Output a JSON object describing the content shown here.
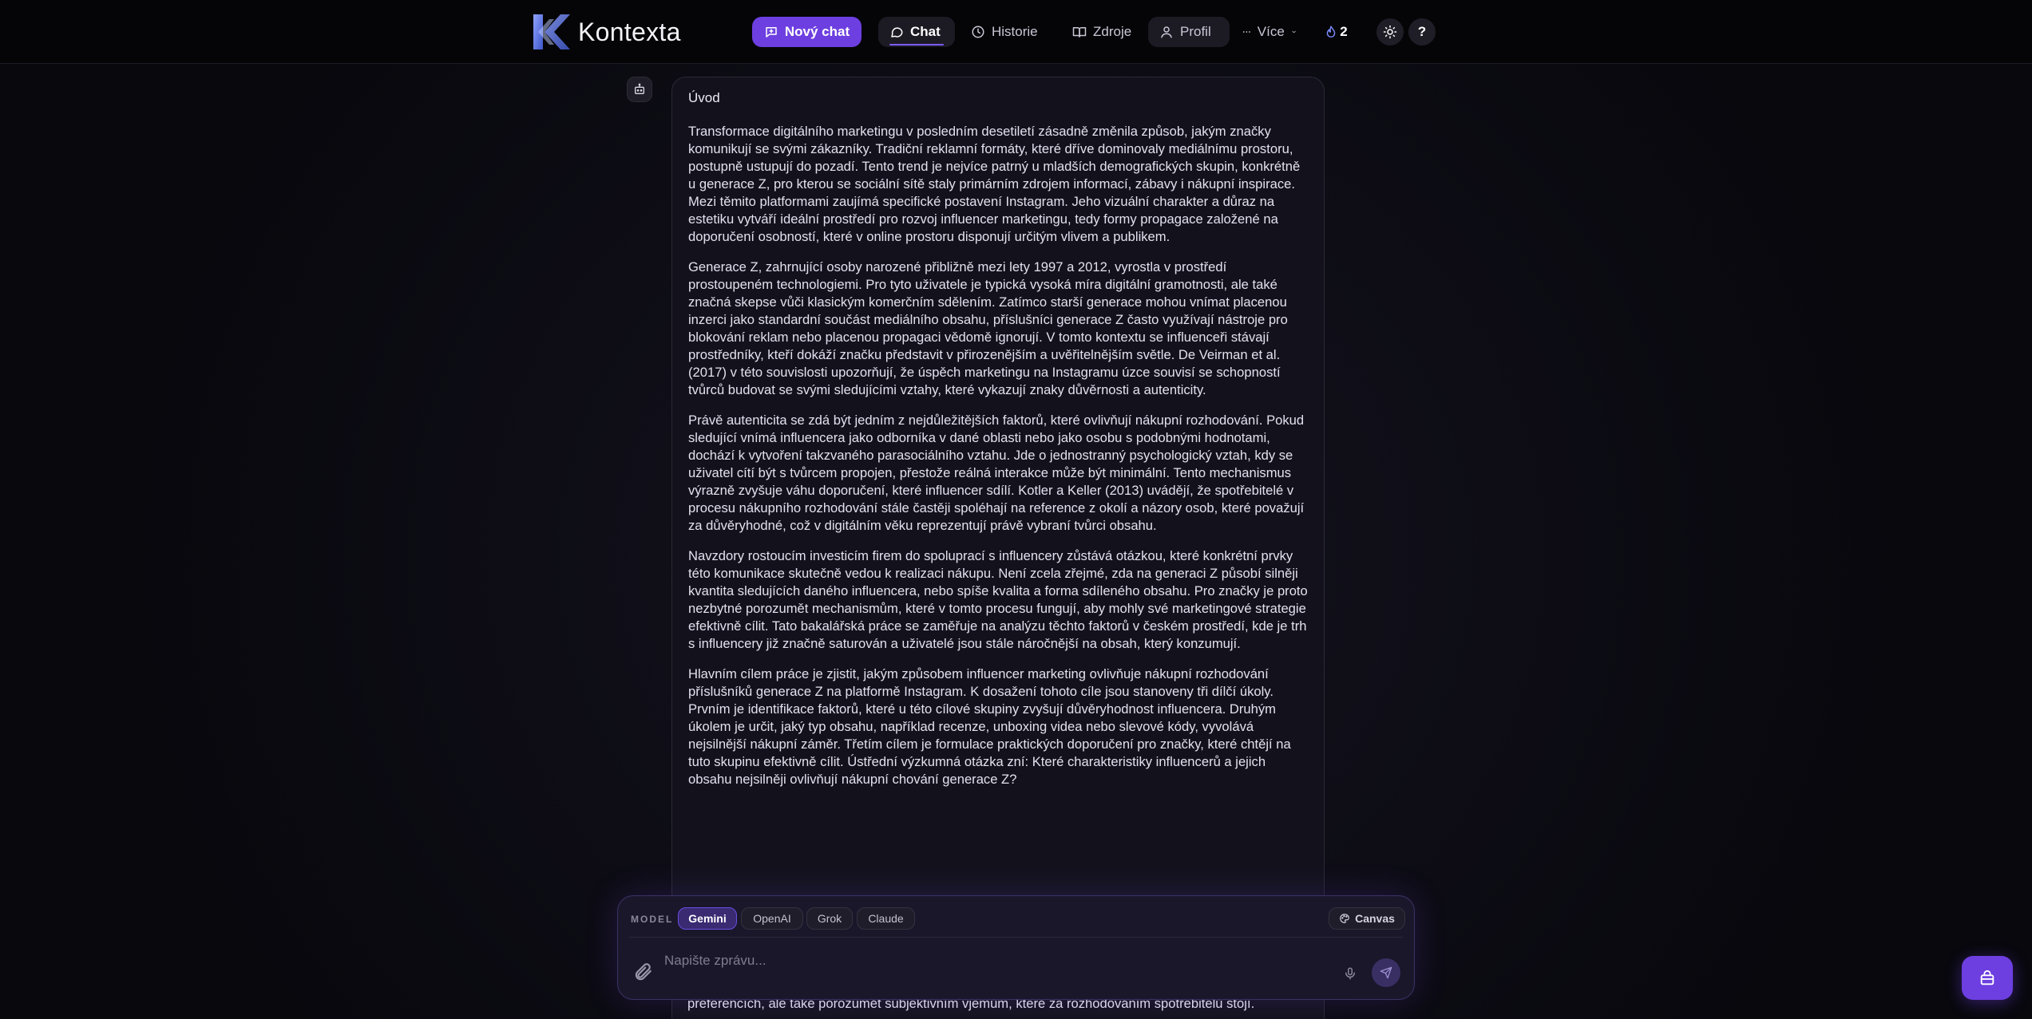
{
  "header": {
    "app_name": "Kontexta",
    "new_chat_label": "Nový chat",
    "nav": {
      "chat": "Chat",
      "history": "Historie",
      "sources": "Zdroje",
      "profile": "Profil",
      "more": "Více"
    },
    "count_badge": "2",
    "help_label": "?"
  },
  "message": {
    "heading": "Úvod",
    "paragraphs": [
      "Transformace digitálního marketingu v posledním desetiletí zásadně změnila způsob, jakým značky komunikují se svými zákazníky. Tradiční reklamní formáty, které dříve dominovaly mediálnímu prostoru, postupně ustupují do pozadí. Tento trend je nejvíce patrný u mladších demografických skupin, konkrétně u generace Z, pro kterou se sociální sítě staly primárním zdrojem informací, zábavy i nákupní inspirace. Mezi těmito platformami zaujímá specifické postavení Instagram. Jeho vizuální charakter a důraz na estetiku vytváří ideální prostředí pro rozvoj influencer marketingu, tedy formy propagace založené na doporučení osobností, které v online prostoru disponují určitým vlivem a publikem.",
      "Generace Z, zahrnující osoby narozené přibližně mezi lety 1997 a 2012, vyrostla v prostředí prostoupeném technologiemi. Pro tyto uživatele je typická vysoká míra digitální gramotnosti, ale také značná skepse vůči klasickým komerčním sdělením. Zatímco starší generace mohou vnímat placenou inzerci jako standardní součást mediálního obsahu, příslušníci generace Z často využívají nástroje pro blokování reklam nebo placenou propagaci vědomě ignorují. V tomto kontextu se influenceři stávají prostředníky, kteří dokáží značku představit v přirozenějším a uvěřitelnějším světle. De Veirman et al. (2017) v této souvislosti upozorňují, že úspěch marketingu na Instagramu úzce souvisí se schopností tvůrců budovat se svými sledujícími vztahy, které vykazují znaky důvěrnosti a autenticity.",
      "Právě autenticita se zdá být jedním z nejdůležitějších faktorů, které ovlivňují nákupní rozhodování. Pokud sledující vnímá influencera jako odborníka v dané oblasti nebo jako osobu s podobnými hodnotami, dochází k vytvoření takzvaného parasociálního vztahu. Jde o jednostranný psychologický vztah, kdy se uživatel cítí být s tvůrcem propojen, přestože reálná interakce může být minimální. Tento mechanismus výrazně zvyšuje váhu doporučení, které influencer sdílí. Kotler a Keller (2013) uvádějí, že spotřebitelé v procesu nákupního rozhodování stále častěji spoléhají na reference z okolí a názory osob, které považují za důvěryhodné, což v digitálním věku reprezentují právě vybraní tvůrci obsahu.",
      "Navzdory rostoucím investicím firem do spoluprací s influencery zůstává otázkou, které konkrétní prvky této komunikace skutečně vedou k realizaci nákupu. Není zcela zřejmé, zda na generaci Z působí silněji kvantita sledujících daného influencera, nebo spíše kvalita a forma sdíleného obsahu. Pro značky je proto nezbytné porozumět mechanismům, které v tomto procesu fungují, aby mohly své marketingové strategie efektivně cílit. Tato bakalářská práce se zaměřuje na analýzu těchto faktorů v českém prostředí, kde je trh s influencery již značně saturován a uživatelé jsou stále náročnější na obsah, který konzumují.",
      "Hlavním cílem práce je zjistit, jakým způsobem influencer marketing ovlivňuje nákupní rozhodování příslušníků generace Z na platformě Instagram. K dosažení tohoto cíle jsou stanoveny tři dílčí úkoly. Prvním je identifikace faktorů, které u této cílové skupiny zvyšují důvěryhodnost influencera. Druhým úkolem je určit, jaký typ obsahu, například recenze, unboxing videa nebo slevové kódy, vyvolává nejsilnější nákupní záměr. Třetím cílem je formulace praktických doporučení pro značky, které chtějí na tuto skupinu efektivně cílit. Ústřední výzkumná otázka zní: Které charakteristiky influencerů a jejich obsahu nejsilněji ovlivňují nákupní chování generace Z?"
    ],
    "trailing_text": "preferencích, ale také porozumět subjektivním vjemům, které za rozhodováním spotřebitelů stojí."
  },
  "composer": {
    "model_label": "MODEL",
    "models": [
      "Gemini",
      "OpenAI",
      "Grok",
      "Claude"
    ],
    "active_model": "Gemini",
    "canvas_label": "Canvas",
    "input_placeholder": "Napište zprávu...",
    "input_value": ""
  },
  "colors": {
    "accent": "#6d3fe0",
    "background": "#0e0d16",
    "card": "#13121c",
    "topbar": "#050507"
  },
  "icons": {
    "new_chat": "chat-plus-icon",
    "chat": "chat-bubble-icon",
    "history": "clock-icon",
    "sources": "book-icon",
    "profile": "user-icon",
    "more": "dots-icon",
    "count": "flame-icon",
    "theme": "sun-icon",
    "bot": "robot-icon",
    "canvas": "palette-icon",
    "attach": "paperclip-icon",
    "mic": "microphone-icon",
    "send": "send-icon",
    "floating": "bag-icon"
  }
}
